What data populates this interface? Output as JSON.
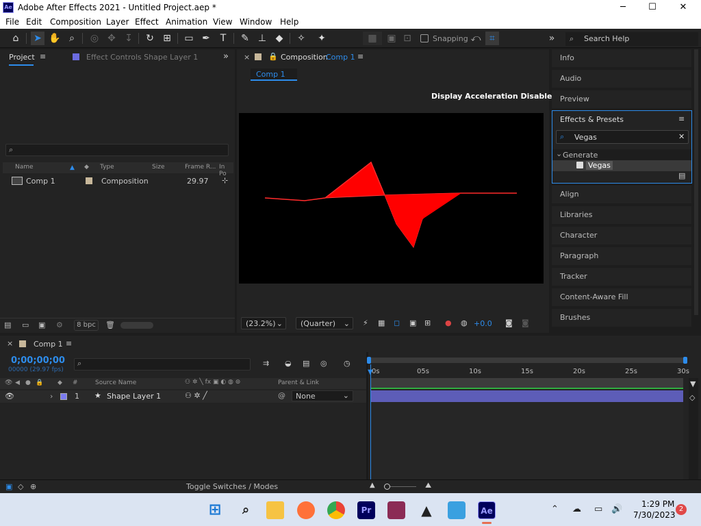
{
  "title_bar": {
    "app_icon": "Ae",
    "title": "Adobe After Effects 2021 - Untitled Project.aep *",
    "minimize": "─",
    "maximize": "☐",
    "close": "✕"
  },
  "menu": [
    "File",
    "Edit",
    "Composition",
    "Layer",
    "Effect",
    "Animation",
    "View",
    "Window",
    "Help"
  ],
  "toolbar": {
    "tools": [
      "home-icon",
      "selection-tool-icon",
      "hand-tool-icon",
      "zoom-tool-icon",
      "orbit-camera-icon",
      "pan-camera-icon",
      "dolly-camera-icon",
      "rotation-tool-icon",
      "pan-behind-icon",
      "rectangle-tool-icon",
      "pen-tool-icon",
      "type-tool-icon",
      "brush-tool-icon",
      "clone-stamp-icon",
      "eraser-icon",
      "roto-brush-icon",
      "puppet-pin-icon"
    ],
    "snapping_label": "Snapping",
    "overflow": "»",
    "search_placeholder": "Search Help"
  },
  "project_panel": {
    "tab_label": "Project",
    "menu_icon": "≡",
    "effect_controls_label": "Effect Controls Shape Layer 1",
    "overflow": "»",
    "columns": [
      "Name",
      "Type",
      "Size",
      "Frame R...",
      "In Po"
    ],
    "rows": [
      {
        "name": "Comp 1",
        "type": "Composition",
        "frame_rate": "29.97"
      }
    ],
    "bpc_label": "8 bpc"
  },
  "composition_panel": {
    "close": "×",
    "tab_prefix": "Composition",
    "tab_name": "Comp 1",
    "menu_icon": "≡",
    "comp_chip": "Comp 1",
    "notice": "Display Acceleration Disabled",
    "zoom": "(23.2%)",
    "resolution": "(Quarter)",
    "exposure": "+0.0"
  },
  "right_panels": {
    "top": [
      "Info",
      "Audio",
      "Preview"
    ],
    "effects_presets": {
      "title": "Effects & Presets",
      "menu_icon": "≡",
      "search_value": "Vegas",
      "clear": "✕",
      "category": "Generate",
      "item": "Vegas"
    },
    "bottom": [
      "Align",
      "Libraries",
      "Character",
      "Paragraph",
      "Tracker",
      "Content-Aware Fill",
      "Brushes"
    ]
  },
  "timeline": {
    "close": "×",
    "comp_name": "Comp 1",
    "menu_icon": "≡",
    "timecode": "0;00;00;00",
    "frame_info": "00000 (29.97 fps)",
    "columns": {
      "num": "#",
      "source_name": "Source Name",
      "parent_link": "Parent & Link"
    },
    "ruler": [
      "0s",
      "05s",
      "10s",
      "15s",
      "20s",
      "25s",
      "30s"
    ],
    "layers": [
      {
        "num": "1",
        "name": "Shape Layer 1",
        "parent": "None",
        "label_color": "#7a7aef"
      }
    ],
    "footer": "Toggle Switches / Modes"
  },
  "taskbar": {
    "time": "1:29 PM",
    "date": "7/30/2023",
    "notification_count": "2",
    "apps": [
      "windows-start-icon",
      "search-icon",
      "file-explorer-icon",
      "firefox-icon",
      "chrome-icon",
      "premiere-pro-icon",
      "winrar-icon",
      "inkscape-icon",
      "notepad-icon",
      "after-effects-icon"
    ],
    "premiere_label": "Pr",
    "ae_label": "Ae"
  },
  "colors": {
    "accent": "#2d8ceb",
    "shape_fill": "#ff0000",
    "layer_bar": "#5d5db8",
    "panel_bg": "#232323"
  }
}
